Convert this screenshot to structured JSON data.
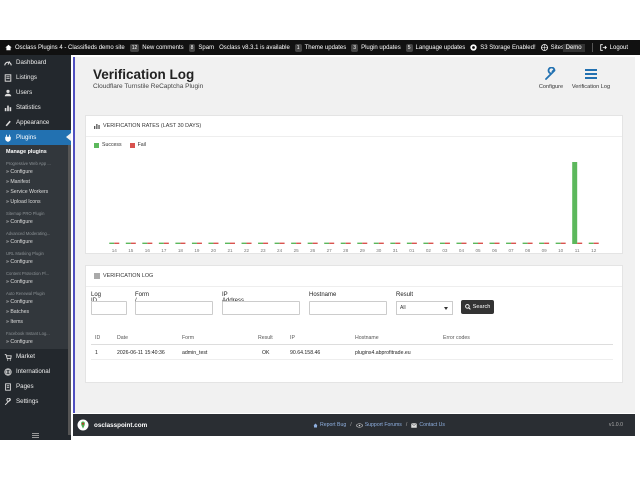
{
  "topbar": {
    "site_name": "Osclass Plugins 4 - Classifieds demo site",
    "comments_count": "12",
    "comments_label": "New comments",
    "spam_count": "8",
    "spam_label": "Spam",
    "update_label": "Osclass v8.3.1 is available",
    "theme_count": "1",
    "theme_label": "Theme updates",
    "plugin_count": "3",
    "plugin_label": "Plugin updates",
    "lang_count": "5",
    "lang_label": "Language updates",
    "s3_label": "S3 Storage Enabled!",
    "sites_label": "Sites",
    "user_label": "Demo",
    "logout_label": "Logout"
  },
  "sidebar": {
    "items_top": [
      {
        "label": "Dashboard",
        "icon": "dashboard-icon"
      },
      {
        "label": "Listings",
        "icon": "listings-icon"
      },
      {
        "label": "Users",
        "icon": "users-icon"
      },
      {
        "label": "Statistics",
        "icon": "statistics-icon"
      },
      {
        "label": "Appearance",
        "icon": "appearance-icon"
      },
      {
        "label": "Plugins",
        "icon": "plugins-icon"
      }
    ],
    "submenu": {
      "manage": "Manage plugins",
      "pwa_section": "Progressive Web App ...",
      "pwa_links": [
        "» Configure",
        "» Manifest",
        "» Service Workers",
        "» Upload Icons"
      ],
      "sitemap_section": "Sitemap PRO Plugin",
      "sitemap_links": [
        "» Configure"
      ],
      "advmod_section": "Advanced Moderating...",
      "advmod_links": [
        "» Configure"
      ],
      "url_section": "URL Masking Plugin",
      "url_links": [
        "» Configure"
      ],
      "cp_section": "Content Protection Pl...",
      "cp_links": [
        "» Configure"
      ],
      "renewal_section": "Auto Renewal Plugin",
      "renewal_links": [
        "» Configure",
        "» Batches",
        "» Items"
      ],
      "fb_section": "Facebook Instant Log...",
      "fb_links": [
        "» Configure"
      ]
    },
    "items_bottom": [
      {
        "label": "Market",
        "icon": "market-icon"
      },
      {
        "label": "International",
        "icon": "globe-icon"
      },
      {
        "label": "Pages",
        "icon": "pages-icon"
      },
      {
        "label": "Settings",
        "icon": "settings-icon"
      }
    ]
  },
  "header": {
    "title": "Verification Log",
    "subtitle": "Cloudflare Turnstile ReCaptcha Plugin",
    "configure_label": "Configure",
    "log_label": "Verification Log"
  },
  "rates_card": {
    "title": "VERIFICATION RATES (LAST 30 DAYS)"
  },
  "chart_data": {
    "type": "bar",
    "categories": [
      "14",
      "15",
      "16",
      "17",
      "18",
      "19",
      "20",
      "21",
      "22",
      "23",
      "24",
      "25",
      "26",
      "27",
      "28",
      "29",
      "30",
      "31",
      "01",
      "02",
      "03",
      "04",
      "05",
      "06",
      "07",
      "08",
      "09",
      "10",
      "11",
      "12"
    ],
    "series": [
      {
        "name": "Success",
        "color": "#5cb85c",
        "values": [
          0,
          0,
          0,
          0,
          0,
          0,
          0,
          0,
          0,
          0,
          0,
          0,
          0,
          0,
          0,
          0,
          0,
          0,
          0,
          0,
          0,
          0,
          0,
          0,
          0,
          0,
          0,
          0,
          1,
          0
        ]
      },
      {
        "name": "Fail",
        "color": "#d9534f",
        "values": [
          0,
          0,
          0,
          0,
          0,
          0,
          0,
          0,
          0,
          0,
          0,
          0,
          0,
          0,
          0,
          0,
          0,
          0,
          0,
          0,
          0,
          0,
          0,
          0,
          0,
          0,
          0,
          0,
          0,
          0
        ]
      }
    ],
    "ylim": [
      0,
      1
    ],
    "legend": "top-left",
    "grid": false
  },
  "log_card": {
    "title": "VERIFICATION LOG",
    "filters": {
      "log_id_label": "Log ID",
      "form_label": "Form / Hook",
      "ip_label": "IP Address",
      "hostname_label": "Hostname",
      "result_label": "Result",
      "result_value": "All",
      "search_label": "Search"
    },
    "columns": [
      "ID",
      "Date",
      "Form",
      "Result",
      "IP",
      "Hostname",
      "Error codes"
    ],
    "rows": [
      {
        "id": "1",
        "date": "2026-06-11 15:40:36",
        "form": "admin_test",
        "result": "OK",
        "ip": "90.64.158.46",
        "hostname": "plugins4.abprofitrade.eu",
        "errors": ""
      }
    ]
  },
  "footer": {
    "logo_text": "osclasspoint.com",
    "report_bug": "Report Bug",
    "support": "Support Forums",
    "contact": "Contact Us",
    "version": "v1.0.0"
  }
}
